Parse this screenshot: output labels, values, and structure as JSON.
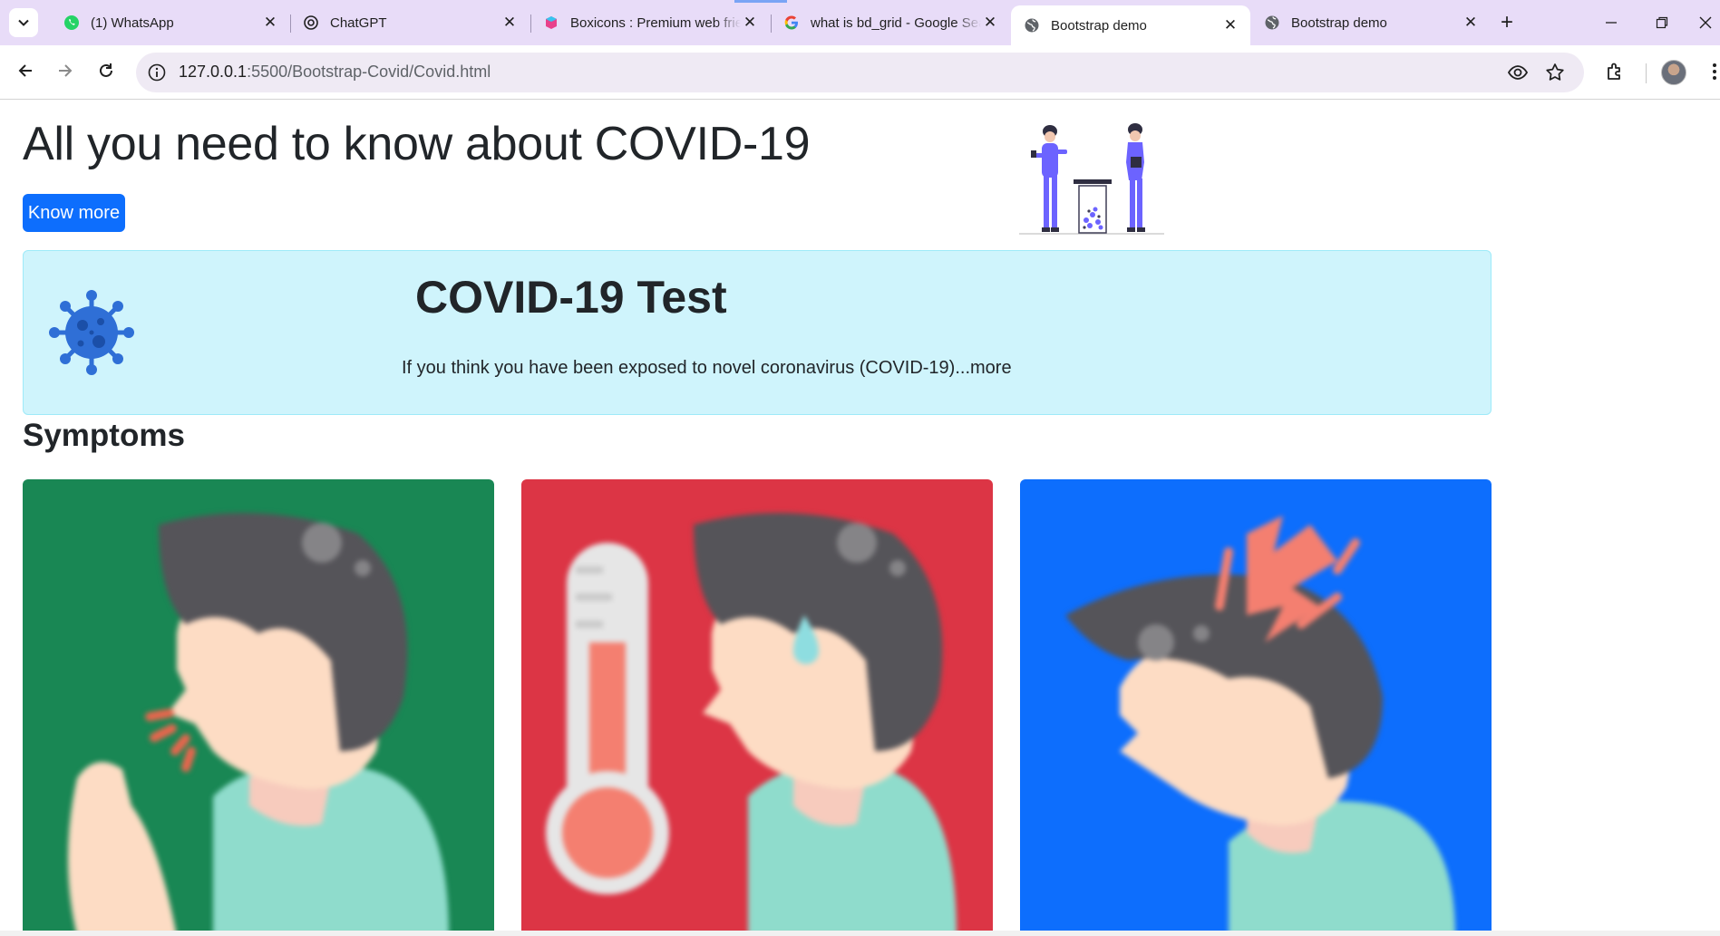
{
  "browser": {
    "tabs": [
      {
        "title": "(1) WhatsApp",
        "icon": "whatsapp-icon",
        "active": false
      },
      {
        "title": "ChatGPT",
        "icon": "chatgpt-icon",
        "active": false
      },
      {
        "title": "Boxicons : Premium web friendly icons",
        "icon": "boxicons-icon",
        "active": false
      },
      {
        "title": "what is bd_grid - Google Search",
        "icon": "google-icon",
        "active": false
      },
      {
        "title": "Bootstrap demo",
        "icon": "globe-icon",
        "active": true
      },
      {
        "title": "Bootstrap demo",
        "icon": "globe-icon",
        "active": false
      }
    ],
    "url_host": "127.0.0.1",
    "url_rest": ":5500/Bootstrap-Covid/Covid.html",
    "colors": {
      "tabstrip": "#e8dcf8",
      "omnibox": "#efeaf4"
    }
  },
  "page": {
    "hero": {
      "title": "All you need to know about COVID-19",
      "button_label": "Know more"
    },
    "test_box": {
      "title": "COVID-19 Test",
      "text": "If you think you have been exposed to novel coronavirus (COVID-19)",
      "link": "...more"
    },
    "symptoms_title": "Symptoms",
    "cards": [
      {
        "name": "cough",
        "color": "#198754"
      },
      {
        "name": "fever",
        "color": "#dc3545"
      },
      {
        "name": "headache",
        "color": "#0d6efd"
      }
    ],
    "colors": {
      "primary": "#0d6efd",
      "info_bg": "#cff4fc",
      "info_border": "#9eeaf9"
    }
  }
}
